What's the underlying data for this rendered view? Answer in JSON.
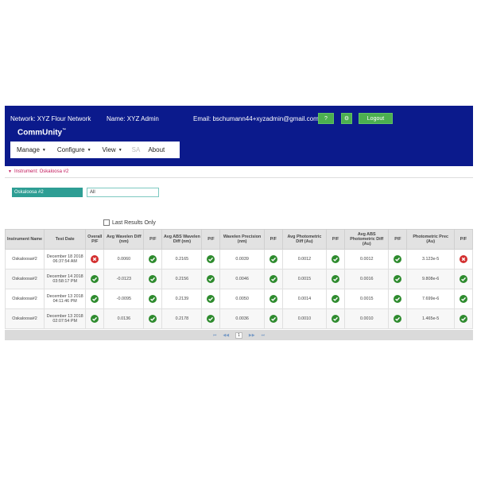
{
  "header": {
    "network": "Network: XYZ Flour Network",
    "name": "Name: XYZ Admin",
    "email": "Email: bschumann44+xyzadmin@gmail.com",
    "help_label": "?",
    "settings_label": "⚙",
    "logout_label": "Logout",
    "brand": "CommUnity",
    "brand_tm": "™"
  },
  "menu": {
    "manage": "Manage",
    "configure": "Configure",
    "view": "View",
    "sa": "SA",
    "about": "About"
  },
  "breadcrumb": {
    "label": "Instrument: Oskaloosa #2"
  },
  "filters": {
    "instrument": "Oskaloosa #2",
    "filter_value": "All"
  },
  "last_results_label": "Last Results Only",
  "table": {
    "headers": [
      "Instrument Name",
      "Test Date",
      "Overall P/F",
      "Avg Wavelen Diff (nm)",
      "P/F",
      "Avg ABS Wavelen Diff (nm)",
      "P/F",
      "Wavelen Precision (nm)",
      "P/F",
      "Avg Photometric Diff (Au)",
      "P/F",
      "Avg ABS Photometric Diff (Au)",
      "P/F",
      "Photometric Prec (Au)",
      "P/F"
    ],
    "rows": [
      [
        "Oskaloosa#2",
        "December 18 2018 06:37:54 AM",
        "fail",
        "0.0060",
        "pass",
        "0.2165",
        "pass",
        "0.0039",
        "pass",
        "0.0012",
        "pass",
        "0.0012",
        "pass",
        "3.123e-5",
        "fail"
      ],
      [
        "Oskaloosa#2",
        "December 14 2018 03:58:17 PM",
        "pass",
        "-0.0123",
        "pass",
        "0.2156",
        "pass",
        "0.0046",
        "pass",
        "0.0015",
        "pass",
        "0.0016",
        "pass",
        "9.808e-6",
        "pass"
      ],
      [
        "Oskaloosa#2",
        "December 13 2018 04:11:46 PM",
        "pass",
        "-0.0095",
        "pass",
        "0.2139",
        "pass",
        "0.0050",
        "pass",
        "0.0014",
        "pass",
        "0.0015",
        "pass",
        "7.699e-6",
        "pass"
      ],
      [
        "Oskaloosa#2",
        "December 13 2018 02:07:54 PM",
        "pass",
        "0.0136",
        "pass",
        "0.2178",
        "pass",
        "0.0036",
        "pass",
        "0.0010",
        "pass",
        "0.0010",
        "pass",
        "1.465e-5",
        "pass"
      ]
    ]
  },
  "pager": {
    "first": "⏮",
    "prev": "◀◀",
    "current": "1",
    "next": "▶▶",
    "last": "⏭"
  },
  "colors": {
    "topbar": "#0b1a8c",
    "button": "#4caf50",
    "pass": "#2e8b2e",
    "fail": "#d32f2f",
    "teal": "#2e9e94"
  }
}
